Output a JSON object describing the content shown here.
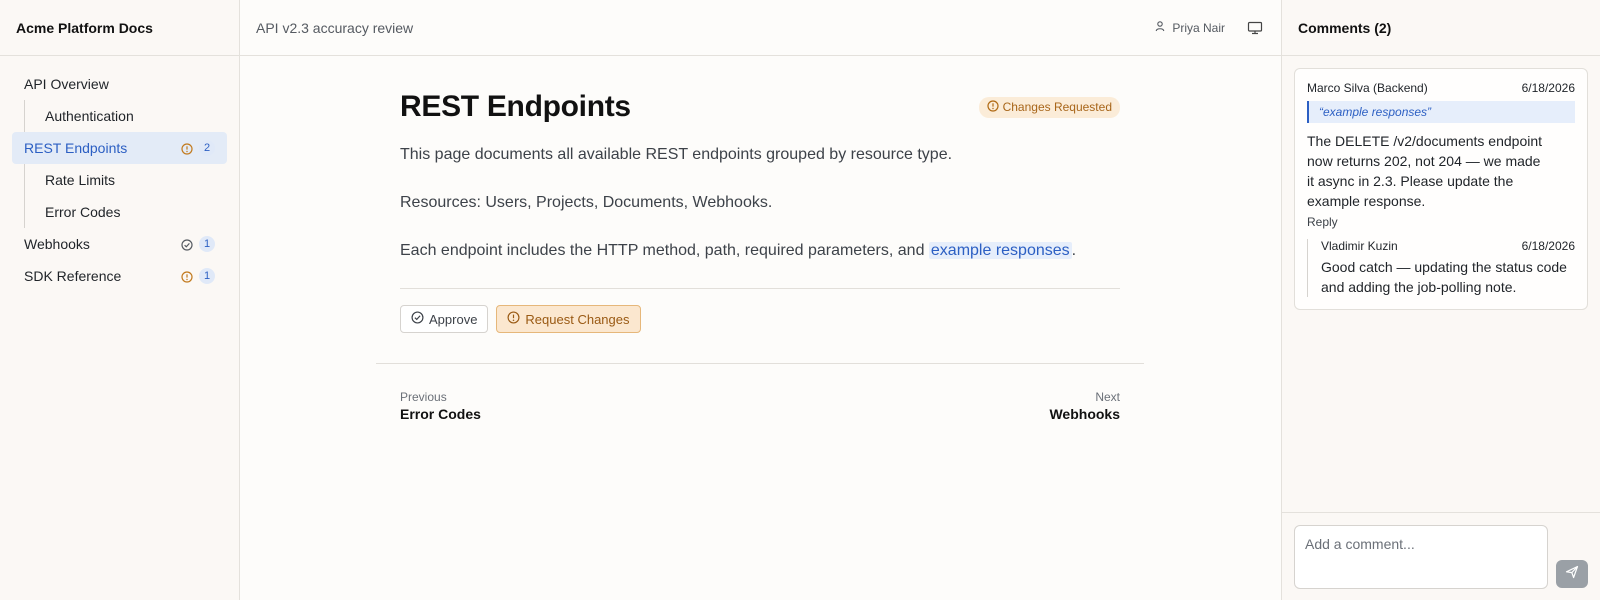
{
  "sidebar": {
    "app_title": "Acme Platform Docs",
    "items": [
      {
        "label": "API Overview"
      },
      {
        "label": "Authentication"
      },
      {
        "label": "REST Endpoints",
        "count": "2",
        "status_icon": "warning-circle-icon"
      },
      {
        "label": "Rate Limits"
      },
      {
        "label": "Error Codes"
      },
      {
        "label": "Webhooks",
        "count": "1",
        "status_icon": "check-circle-icon"
      },
      {
        "label": "SDK Reference",
        "count": "1",
        "status_icon": "warning-circle-icon"
      }
    ]
  },
  "topbar": {
    "doc_title": "API v2.3 accuracy review",
    "user_name": "Priya Nair",
    "user_icon": "user-icon",
    "monitor_icon": "monitor-icon"
  },
  "main": {
    "page_title": "REST Endpoints",
    "status_badge": "Changes Requested",
    "paragraphs": {
      "p1": "This page documents all available REST endpoints grouped by resource type.",
      "p2": "Resources: Users, Projects, Documents, Webhooks.",
      "p3_before": "Each endpoint includes the HTTP method, path, required parameters, and ",
      "p3_highlight": "example responses",
      "p3_after": "."
    },
    "approve_label": "Approve",
    "request_changes_label": "Request Changes",
    "pager": {
      "prev_caption": "Previous",
      "prev_target": "Error Codes",
      "next_caption": "Next",
      "next_target": "Webhooks"
    }
  },
  "comments": {
    "title": "Comments (2)",
    "thread": {
      "author": "Marco Silva (Backend)",
      "date": "6/18/2026",
      "quote": "“example responses”",
      "text": "The DELETE /v2/documents endpoint now returns 202, not 204 — we made it async in 2.3. Please update the example response.",
      "reply_label": "Reply",
      "reply": {
        "author": "Vladimir Kuzin",
        "date": "6/18/2026",
        "text": "Good catch — updating the status code and adding the job-polling note."
      }
    },
    "composer": {
      "placeholder": "Add a comment..."
    }
  },
  "colors": {
    "accent": "#2c5fc3",
    "warning": "#b06a14",
    "active_bg": "#e3ebf7"
  }
}
